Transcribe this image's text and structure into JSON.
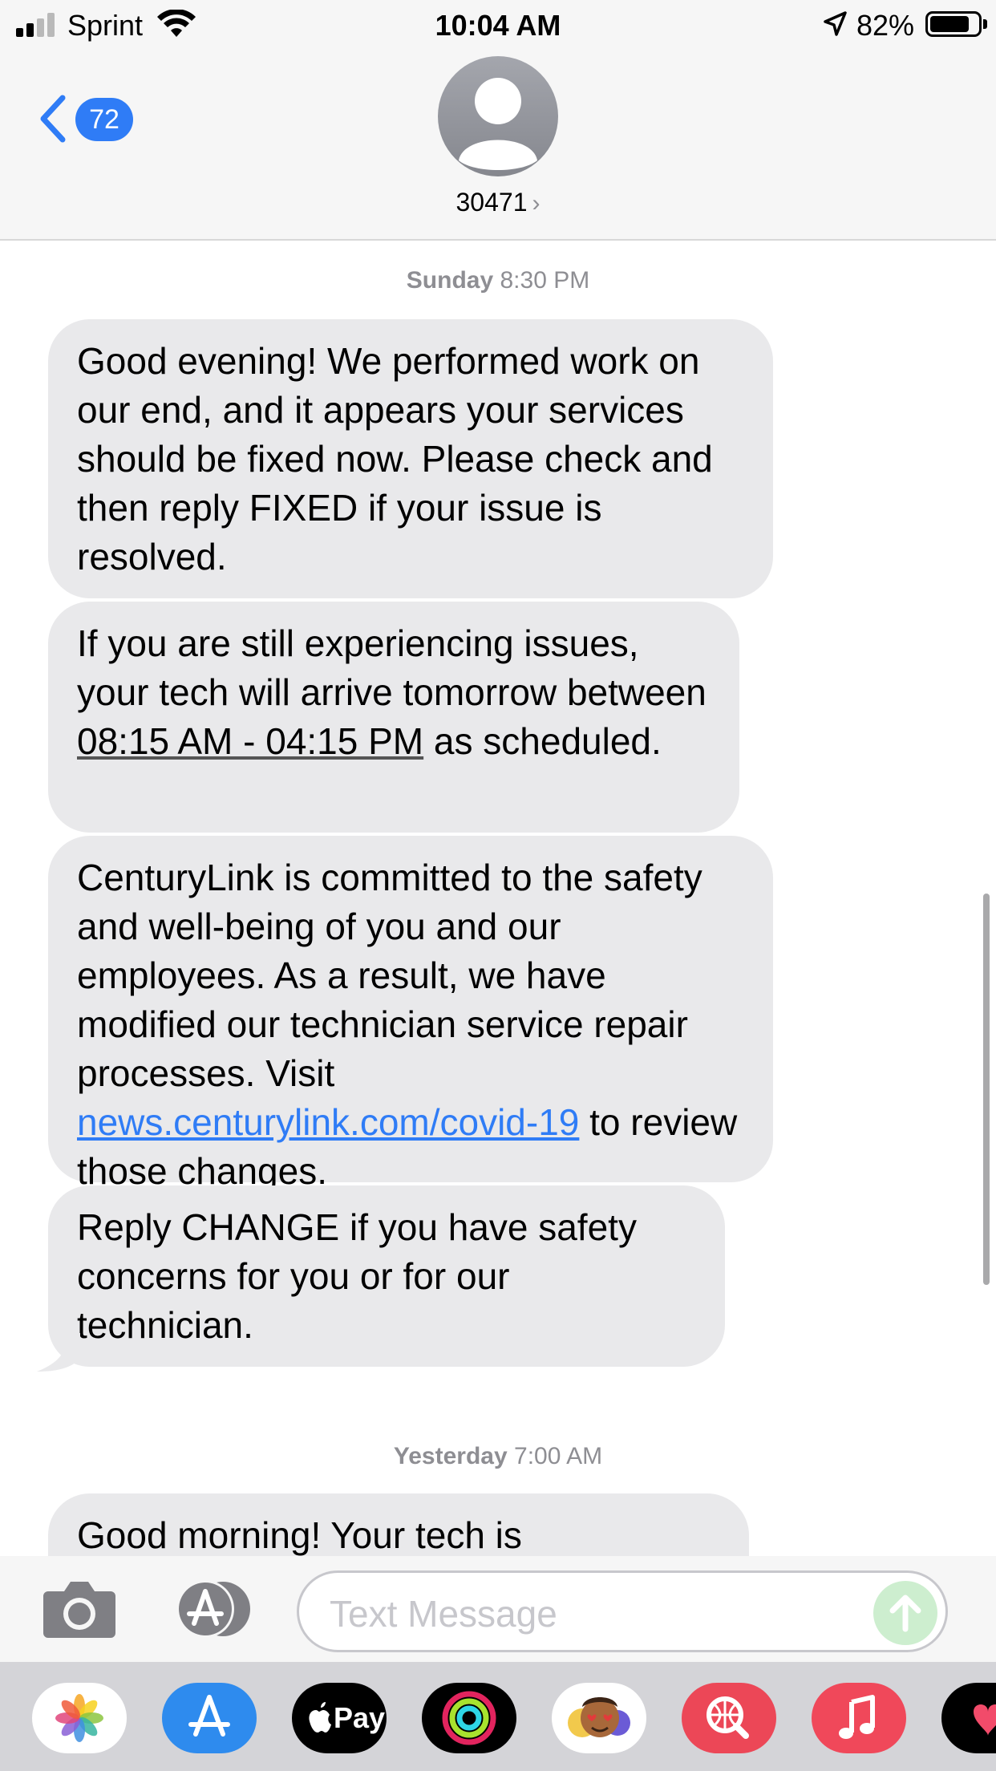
{
  "status_bar": {
    "carrier": "Sprint",
    "time": "10:04 AM",
    "battery_percent": "82%",
    "battery_level": 0.82,
    "signal_bars": 2,
    "signal_bars_total": 4,
    "icons": [
      "signal-icon",
      "wifi-icon",
      "location-icon",
      "battery-icon"
    ]
  },
  "header": {
    "back_badge": "72",
    "contact_name": "30471",
    "icons": [
      "chevron-left-icon",
      "person-avatar-icon",
      "chevron-right-icon"
    ]
  },
  "conversation": {
    "groups": [
      {
        "timestamp_day": "Sunday",
        "timestamp_time": "8:30 PM",
        "messages": [
          {
            "text": "Good evening! We performed work on our end, and it appears your services should be fixed now. Please check and then reply FIXED if your issue is resolved."
          },
          {
            "text_before": "If you are still experiencing issues, your tech will arrive tomorrow between ",
            "time_range": "08:15 AM - 04:15 PM",
            "text_after": " as scheduled."
          },
          {
            "text_before": "CenturyLink is committed to the safety and well-being of you and our employees. As a result, we have modified our technician service repair processes. Visit ",
            "link": "news.centurylink.com/covid-19",
            "text_after": " to review those changes."
          },
          {
            "text": "Reply CHANGE if you have safety concerns for you or for our technician."
          }
        ]
      },
      {
        "timestamp_day": "Yesterday",
        "timestamp_time": "7:00 AM",
        "messages": [
          {
            "text": "Good morning! Your tech is"
          }
        ]
      }
    ]
  },
  "input_bar": {
    "placeholder": "Text Message",
    "icons": [
      "camera-icon",
      "app-store-icon",
      "send-arrow-icon"
    ]
  },
  "app_drawer": {
    "apps": [
      {
        "name": "photos-icon"
      },
      {
        "name": "app-store-icon"
      },
      {
        "name": "apple-pay-icon",
        "label": "Pay"
      },
      {
        "name": "activity-icon"
      },
      {
        "name": "memoji-stickers-icon"
      },
      {
        "name": "images-search-icon"
      },
      {
        "name": "music-icon"
      },
      {
        "name": "digital-touch-icon"
      }
    ]
  },
  "colors": {
    "accent_blue": "#2f7cf6",
    "bubble_gray": "#e9e9eb",
    "header_gray": "#f6f6f6",
    "timestamp_gray": "#8e8e93",
    "send_green_disabled": "#cdeecf"
  }
}
